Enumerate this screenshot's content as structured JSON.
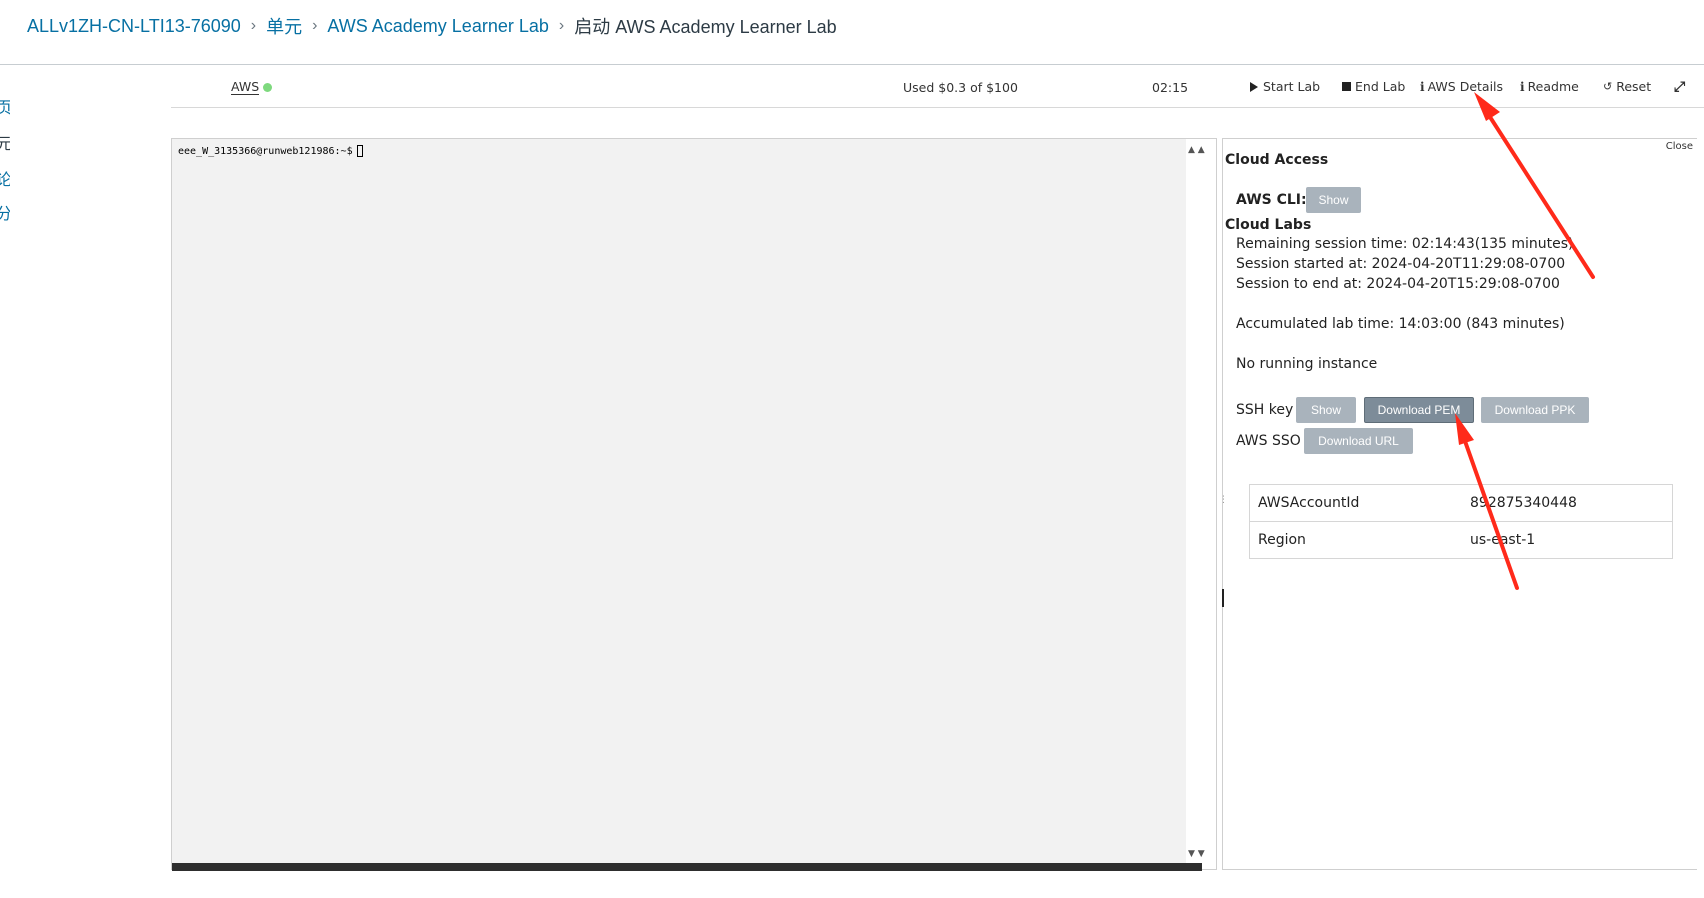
{
  "breadcrumb": {
    "items": [
      "ALLv1ZH-CN-LTI13-76090",
      "单元",
      "AWS Academy Learner Lab"
    ],
    "current": "启动 AWS Academy Learner Lab",
    "separator": "›"
  },
  "left_nav": [
    "页",
    "元",
    "论",
    "分"
  ],
  "toolbar": {
    "aws_label": "AWS",
    "status_color": "#7ed97e",
    "budget": "Used $0.3 of $100",
    "timer": "02:15",
    "start_lab": "Start Lab",
    "end_lab": "End Lab",
    "aws_details": "AWS Details",
    "readme": "Readme",
    "reset": "Reset"
  },
  "terminal": {
    "prompt": "eee_W_3135366@runweb121986:~$"
  },
  "panel": {
    "close": "Close",
    "cloud_access": "Cloud Access",
    "aws_cli_label": "AWS CLI:",
    "show": "Show",
    "cloud_labs": "Cloud Labs",
    "remaining": "Remaining session time: 02:14:43(135 minutes)",
    "started": "Session started at: 2024-04-20T11:29:08-0700",
    "to_end": "Session to end  at: 2024-04-20T15:29:08-0700",
    "accumulated": "Accumulated lab time: 14:03:00 (843 minutes)",
    "no_instance": "No running instance",
    "ssh_key_label": "SSH key",
    "download_pem": "Download PEM",
    "download_ppk": "Download PPK",
    "aws_sso_label": "AWS SSO",
    "download_url": "Download URL",
    "table": [
      {
        "key": "AWSAccountId",
        "value": "892875340448"
      },
      {
        "key": "Region",
        "value": "us-east-1"
      }
    ]
  },
  "colors": {
    "link": "#0770a3",
    "button": "#a9b3bc",
    "annotation": "#ff2a1a"
  }
}
